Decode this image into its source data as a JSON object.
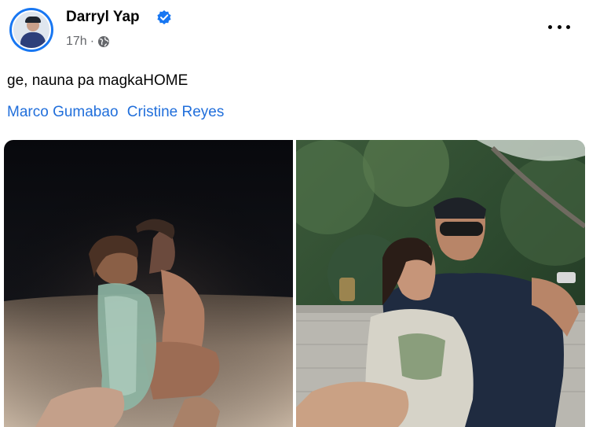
{
  "post": {
    "author": "Darryl Yap",
    "time": "17h",
    "separator": "·",
    "caption": "ge, nauna pa magkaHOME",
    "tags": [
      "Marco Gumabao",
      "Cristine Reyes"
    ]
  },
  "icons": {
    "verified": "verified-badge-icon",
    "audience": "globe-icon",
    "more": "more-options-icon"
  },
  "colors": {
    "accent": "#1877f2",
    "link": "#216fdb",
    "meta": "#65676b"
  }
}
